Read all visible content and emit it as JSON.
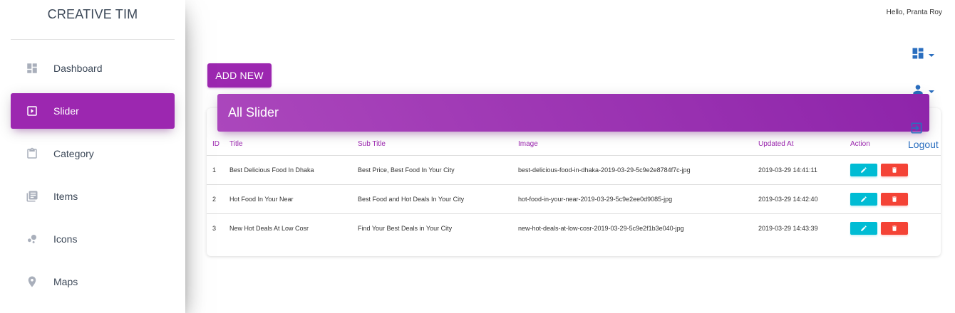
{
  "brand": "CREATIVE TIM",
  "header": {
    "greeting": "Hello, Pranta Roy",
    "logout": "Logout"
  },
  "sidebar": {
    "items": [
      {
        "label": "Dashboard",
        "icon": "dashboard-icon"
      },
      {
        "label": "Slider",
        "icon": "slideshow-icon",
        "active": true
      },
      {
        "label": "Category",
        "icon": "clipboard-icon"
      },
      {
        "label": "Items",
        "icon": "library-books-icon"
      },
      {
        "label": "Icons",
        "icon": "bubble-chart-icon"
      },
      {
        "label": "Maps",
        "icon": "location-pin-icon"
      }
    ]
  },
  "main": {
    "add_button": "ADD NEW",
    "card_title": "All Slider",
    "table": {
      "headers": {
        "id": "ID",
        "title": "Title",
        "subtitle": "Sub Title",
        "image": "Image",
        "updated": "Updated At",
        "action": "Action"
      },
      "rows": [
        {
          "id": "1",
          "title": "Best Delicious Food In Dhaka",
          "subtitle": "Best Price, Best Food In Your City",
          "image": "best-delicious-food-in-dhaka-2019-03-29-5c9e2e8784f7c-jpg",
          "updated": "2019-03-29 14:41:11"
        },
        {
          "id": "2",
          "title": "Hot Food In Your Near",
          "subtitle": "Best Food and Hot Deals In Your City",
          "image": "hot-food-in-your-near-2019-03-29-5c9e2ee0d9085-jpg",
          "updated": "2019-03-29 14:42:40"
        },
        {
          "id": "3",
          "title": "New Hot Deals At Low Cosr",
          "subtitle": "Find Your Best Deals in Your City",
          "image": "new-hot-deals-at-low-cosr-2019-03-29-5c9e2f1b3e040-jpg",
          "updated": "2019-03-29 14:43:39"
        }
      ]
    }
  },
  "colors": {
    "primary": "#9c27b0",
    "info": "#00bcd4",
    "danger": "#f44336",
    "link": "#2a6ebf"
  }
}
